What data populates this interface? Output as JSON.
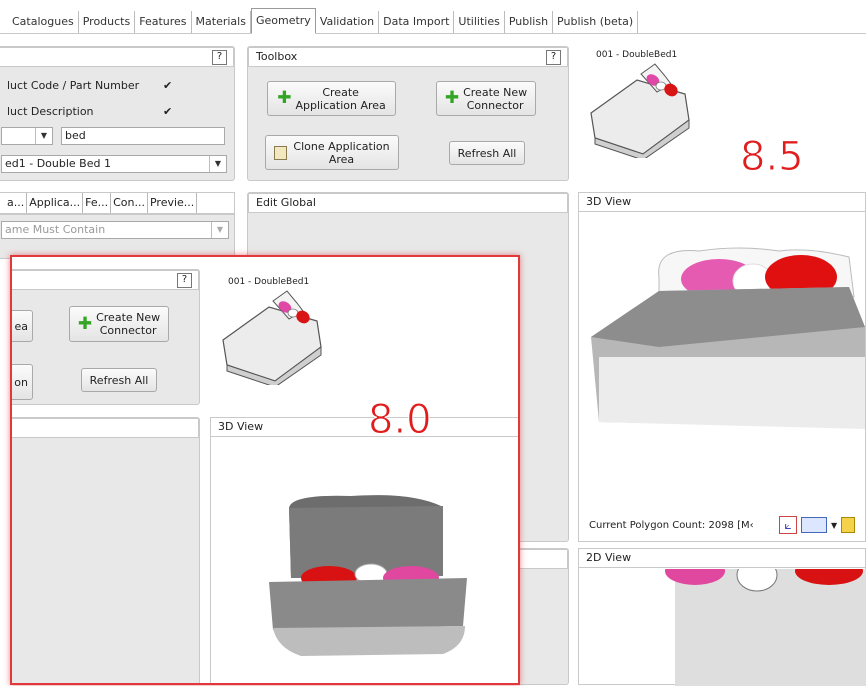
{
  "tabs": [
    {
      "label": "Catalogues",
      "active": false
    },
    {
      "label": "Products",
      "active": false
    },
    {
      "label": "Features",
      "active": false
    },
    {
      "label": "Materials",
      "active": false
    },
    {
      "label": "Geometry",
      "active": true
    },
    {
      "label": "Validation",
      "active": false
    },
    {
      "label": "Data Import",
      "active": false
    },
    {
      "label": "Utilities",
      "active": false
    },
    {
      "label": "Publish",
      "active": false
    },
    {
      "label": "Publish (beta)",
      "active": false
    }
  ],
  "left": {
    "help": "?",
    "opt1": "luct Code / Part Number",
    "opt2": "luct Description",
    "check": "✔",
    "search_value": "bed",
    "selected_item": "ed1 - Double Bed 1",
    "subtabs": [
      "a...",
      "Applica...",
      "Fe...",
      "Con...",
      "Previe..."
    ],
    "filter_placeholder": "ame Must Contain"
  },
  "toolbox": {
    "title": "Toolbox",
    "help": "?",
    "create_area": "Create\nApplication Area",
    "create_conn": "Create New\nConnector",
    "clone": "Clone Application\nArea",
    "refresh": "Refresh All"
  },
  "preview": {
    "caption": "001 - DoubleBed1"
  },
  "version_new": "8.5",
  "version_old": "8.0",
  "edit_global": {
    "title": "Edit Global"
  },
  "view3d": {
    "title": "3D View",
    "polycount": "Current Polygon Count: 2098 [M‹"
  },
  "view2d": {
    "title": "2D View"
  },
  "overlay": {
    "help": "?",
    "btn_partial": "ea",
    "btn_partial2": "on",
    "create_conn": "Create New\nConnector",
    "refresh": "Refresh All",
    "caption": "001 - DoubleBed1",
    "view3d_title": "3D View"
  },
  "colors": {
    "accent": "#e0393b",
    "green": "#32a524"
  }
}
